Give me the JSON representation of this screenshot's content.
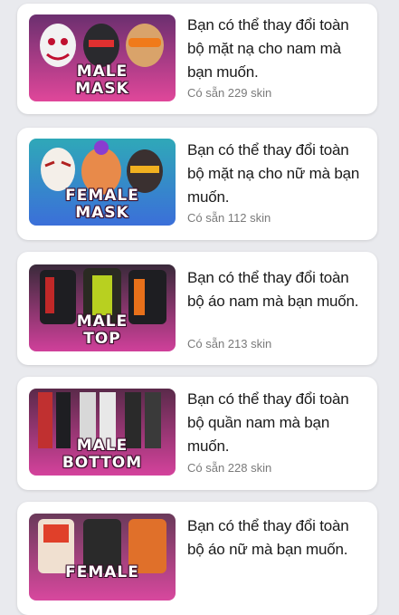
{
  "cards": [
    {
      "label": "MALE\nMASK",
      "desc": "Bạn có thể thay đổi toàn bộ mặt nạ cho nam mà bạn muốn.",
      "count": "Có sẵn 229 skin"
    },
    {
      "label": "FEMALE\nMASK",
      "desc": "Bạn có thể thay đổi toàn bộ mặt nạ cho nữ mà bạn muốn.",
      "count": "Có sẵn 112 skin"
    },
    {
      "label": "MALE\nTOP",
      "desc": "Bạn có thể thay đổi toàn bộ áo nam mà bạn muốn.",
      "count": "Có sẵn 213 skin"
    },
    {
      "label": "MALE\nBOTTOM",
      "desc": "Bạn có thể thay đổi toàn bộ quần nam mà bạn muốn.",
      "count": "Có sẵn 228 skin"
    },
    {
      "label": "FEMALE",
      "desc": "Bạn có thể thay đổi toàn bộ áo nữ mà bạn muốn.",
      "count": ""
    }
  ]
}
